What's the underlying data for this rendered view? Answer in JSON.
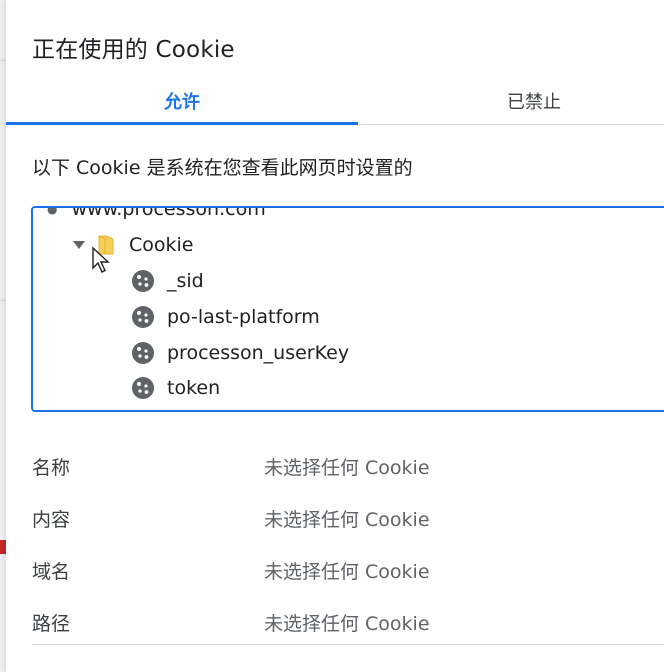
{
  "dialog": {
    "title": "正在使用的 Cookie",
    "tabs": [
      {
        "label": "允许",
        "active": true
      },
      {
        "label": "已禁止",
        "active": false
      }
    ],
    "description": "以下 Cookie 是系统在您查看此网页时设置的"
  },
  "tree": {
    "domain": "www.processon.com",
    "folder_label": "Cookie",
    "cookies": [
      "_sid",
      "po-last-platform",
      "processon_userKey",
      "token"
    ]
  },
  "details": [
    {
      "key": "名称",
      "value": "未选择任何 Cookie"
    },
    {
      "key": "内容",
      "value": "未选择任何 Cookie"
    },
    {
      "key": "域名",
      "value": "未选择任何 Cookie"
    },
    {
      "key": "路径",
      "value": "未选择任何 Cookie"
    }
  ],
  "colors": {
    "accent": "#1a73e8",
    "folder": "#f6cf57",
    "text_muted": "#5f6368"
  },
  "icons": {
    "cookie": "cookie-icon",
    "folder": "folder-icon",
    "expand": "triangle-down-icon",
    "cursor": "mouse-pointer-icon"
  }
}
